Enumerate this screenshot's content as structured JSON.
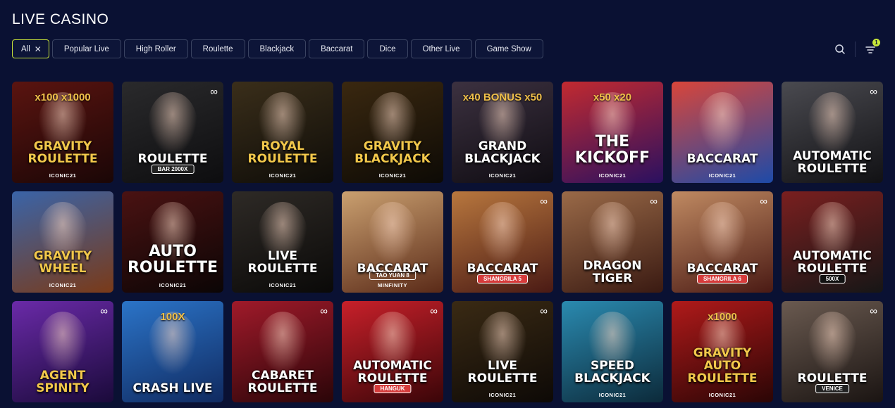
{
  "header": {
    "title": "LIVE CASINO"
  },
  "filters": [
    {
      "label": "All",
      "active": true
    },
    {
      "label": "Popular Live"
    },
    {
      "label": "High Roller"
    },
    {
      "label": "Roulette"
    },
    {
      "label": "Blackjack"
    },
    {
      "label": "Baccarat"
    },
    {
      "label": "Dice"
    },
    {
      "label": "Other Live"
    },
    {
      "label": "Game Show"
    }
  ],
  "tools": {
    "search_icon": "search-icon",
    "filter_icon": "filter-icon",
    "filter_badge": "1",
    "accent": "#c9e83a"
  },
  "games": [
    {
      "title": "GRAVITY ROULETTE",
      "top": "x100 x1000",
      "provider": "ICONIC21",
      "bg": [
        "#5a1410",
        "#1a0606"
      ],
      "titleClass": "gold"
    },
    {
      "title": "ROULETTE",
      "pill": "BAR 2000X",
      "pillColor": "#222",
      "bg": [
        "#2a2a2c",
        "#0d0d0f"
      ],
      "infinity": true
    },
    {
      "title": "ROYAL ROULETTE",
      "provider": "ICONIC21",
      "bg": [
        "#3a2e1a",
        "#0e0c08"
      ],
      "titleClass": "gold"
    },
    {
      "title": "GRAVITY BLACKJACK",
      "provider": "ICONIC21",
      "bg": [
        "#3a2810",
        "#0d0a05"
      ],
      "titleClass": "gold"
    },
    {
      "title": "GRAND BLACKJACK",
      "top": "x40 BONUS x50",
      "provider": "ICONIC21",
      "bg": [
        "#3c3140",
        "#0f0c12"
      ]
    },
    {
      "title": "THE KICKOFF",
      "top": "x50 x20",
      "provider": "ICONIC21",
      "bg": [
        "#c22a30",
        "#2a1060"
      ],
      "titleClass": "big"
    },
    {
      "title": "BACCARAT",
      "provider": "ICONIC21",
      "bg": [
        "#d9463a",
        "#1d4aa8"
      ]
    },
    {
      "title": "AUTOMATIC ROULETTE",
      "bg": [
        "#4a4a50",
        "#111114"
      ],
      "infinity": true
    },
    {
      "title": "GRAVITY WHEEL",
      "provider": "ICONIC21",
      "bg": [
        "#3a64a8",
        "#7a3a18"
      ],
      "titleClass": "gold"
    },
    {
      "title": "AUTO ROULETTE",
      "provider": "ICONIC21",
      "bg": [
        "#4a1212",
        "#0b0505"
      ],
      "titleClass": "big"
    },
    {
      "title": "LIVE ROULETTE",
      "provider": "ICONIC21",
      "bg": [
        "#2e2a26",
        "#0a0908"
      ]
    },
    {
      "title": "BACCARAT",
      "pill": "TAO YUAN 8",
      "pillColor": "transparent",
      "provider": "MINFINITY",
      "bg": [
        "#caa070",
        "#5a2a18"
      ]
    },
    {
      "title": "BACCARAT",
      "pill": "SHANGRILA 5",
      "bg": [
        "#b8773e",
        "#4a1a14"
      ],
      "infinity": true
    },
    {
      "title": "DRAGON TIGER",
      "bg": [
        "#9a6a48",
        "#3a1a12"
      ],
      "infinity": true
    },
    {
      "title": "BACCARAT",
      "pill": "SHANGRILA 6",
      "bg": [
        "#c08a62",
        "#4a1a14"
      ],
      "infinity": true
    },
    {
      "title": "AUTOMATIC ROULETTE",
      "pill": "500X",
      "pillColor": "#111",
      "bg": [
        "#7a1f1f",
        "#161616"
      ]
    },
    {
      "title": "AGENT SPINITY",
      "bg": [
        "#6a2aa8",
        "#1a0a3a"
      ],
      "titleClass": "gold",
      "infinity": true
    },
    {
      "title": "CRASH LIVE",
      "top": "100X",
      "bg": [
        "#2b74c8",
        "#102a60"
      ]
    },
    {
      "title": "CABARET ROULETTE",
      "bg": [
        "#a01a2a",
        "#2a0508"
      ],
      "infinity": true
    },
    {
      "title": "AUTOMATIC ROULETTE",
      "pill": "HANGUK",
      "bg": [
        "#c8202a",
        "#3a0508"
      ],
      "infinity": true
    },
    {
      "title": "LIVE ROULETTE",
      "provider": "ICONIC21",
      "bg": [
        "#3a2a14",
        "#0d0906"
      ],
      "infinity": true
    },
    {
      "title": "SPEED BLACKJACK",
      "provider": "ICONIC21",
      "bg": [
        "#2a8ab0",
        "#0c2a3a"
      ]
    },
    {
      "title": "GRAVITY AUTO ROULETTE",
      "top": "x1000",
      "provider": "ICONIC21",
      "bg": [
        "#b01a1a",
        "#2a0505"
      ],
      "titleClass": "gold"
    },
    {
      "title": "ROULETTE",
      "pill": "VENICE",
      "pillColor": "#222",
      "bg": [
        "#6a5a50",
        "#1a1412"
      ],
      "infinity": true
    }
  ]
}
